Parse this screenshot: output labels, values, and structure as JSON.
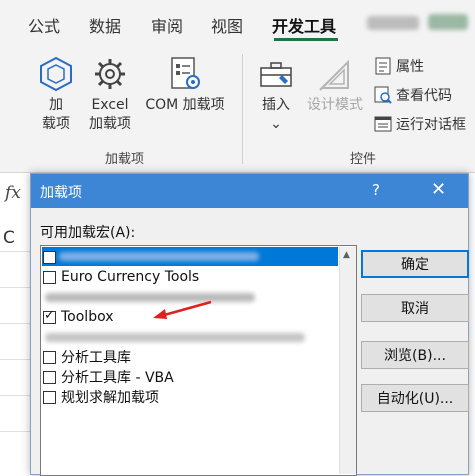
{
  "ribbon_tabs": [
    "公式",
    "数据",
    "审阅",
    "视图",
    "开发工具"
  ],
  "active_tab": "开发工具",
  "addins_group": {
    "label": "加载项",
    "buttons": [
      {
        "line1": "加",
        "line2": "载项",
        "icon": "addin-hexagon-icon"
      },
      {
        "line1": "Excel",
        "line2": "加载项",
        "icon": "gear-icon"
      },
      {
        "line1": "COM 加载项",
        "line2": "",
        "icon": "com-addin-icon"
      }
    ]
  },
  "controls_group": {
    "label": "控件",
    "insert": {
      "line1": "插入",
      "line2": "⌄",
      "icon": "toolbox-icon"
    },
    "design_mode": {
      "label": "设计模式",
      "icon": "ruler-triangle-icon",
      "disabled": true
    },
    "small_buttons": [
      {
        "label": "属性",
        "icon": "properties-icon"
      },
      {
        "label": "查看代码",
        "icon": "view-code-icon"
      },
      {
        "label": "运行对话框",
        "icon": "run-dialog-icon"
      }
    ]
  },
  "formula_bar": {
    "fx": "fx"
  },
  "sheet": {
    "column_label": "C"
  },
  "dialog": {
    "title": "加载项",
    "help": "?",
    "close": "✕",
    "available_label": "可用加载宏(A):",
    "items": [
      {
        "label": "",
        "checked": false,
        "selected": true,
        "obscured": true
      },
      {
        "label": "Euro Currency Tools",
        "checked": false
      },
      {
        "label": "",
        "checked": false,
        "obscured": true
      },
      {
        "label": "Toolbox",
        "checked": true
      },
      {
        "label": "",
        "checked": false,
        "obscured": true
      },
      {
        "label": "分析工具库",
        "checked": false
      },
      {
        "label": "分析工具库 - VBA",
        "checked": false
      },
      {
        "label": "规划求解加载项",
        "checked": false
      }
    ],
    "buttons": {
      "ok": "确定",
      "cancel": "取消",
      "browse": "浏览(B)...",
      "automation": "自动化(U)..."
    }
  },
  "colors": {
    "accent_green": "#217346",
    "dialog_title_bg": "#3d86d6",
    "selection_blue": "#0078d7",
    "annotation_red": "#e02020"
  }
}
